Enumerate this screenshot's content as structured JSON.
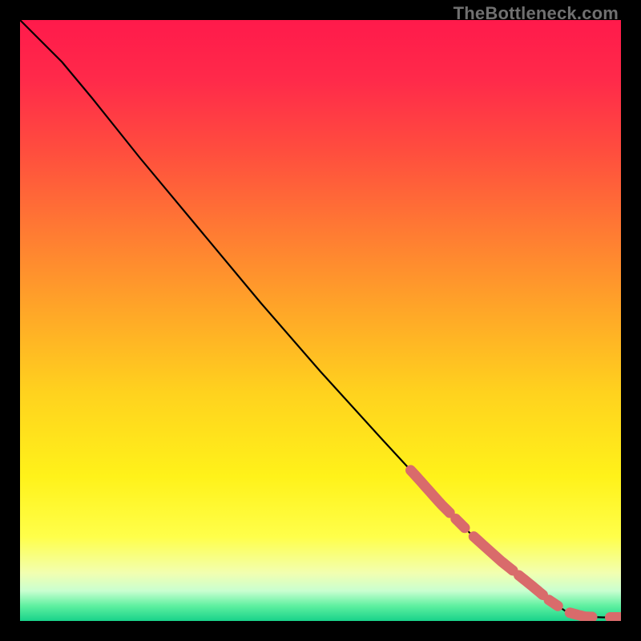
{
  "attribution": "TheBottleneck.com",
  "chart_data": {
    "type": "line",
    "title": "",
    "xlabel": "",
    "ylabel": "",
    "xlim": [
      0,
      100
    ],
    "ylim": [
      0,
      100
    ],
    "curve": [
      {
        "x": 0,
        "y": 100
      },
      {
        "x": 3,
        "y": 97
      },
      {
        "x": 7,
        "y": 93
      },
      {
        "x": 12,
        "y": 87
      },
      {
        "x": 20,
        "y": 77
      },
      {
        "x": 30,
        "y": 65
      },
      {
        "x": 40,
        "y": 53
      },
      {
        "x": 50,
        "y": 41.5
      },
      {
        "x": 60,
        "y": 30.5
      },
      {
        "x": 66,
        "y": 24
      },
      {
        "x": 70,
        "y": 19.5
      },
      {
        "x": 75,
        "y": 14.5
      },
      {
        "x": 80,
        "y": 10
      },
      {
        "x": 85,
        "y": 6
      },
      {
        "x": 88,
        "y": 3.5
      },
      {
        "x": 91,
        "y": 1.5
      },
      {
        "x": 94,
        "y": 0.7
      },
      {
        "x": 97,
        "y": 0.6
      },
      {
        "x": 100,
        "y": 0.6
      }
    ],
    "highlight_segments": [
      {
        "x0": 65.0,
        "x1": 71.5
      },
      {
        "x0": 72.5,
        "x1": 74.0
      },
      {
        "x0": 75.5,
        "x1": 82.0
      },
      {
        "x0": 83.0,
        "x1": 87.0
      },
      {
        "x0": 88.0,
        "x1": 89.5
      },
      {
        "x0": 91.5,
        "x1": 92.8
      },
      {
        "x0": 93.2,
        "x1": 95.2
      },
      {
        "x0": 98.2,
        "x1": 100.0
      }
    ],
    "highlight_color": "#d96b6b",
    "curve_color": "#000000"
  }
}
